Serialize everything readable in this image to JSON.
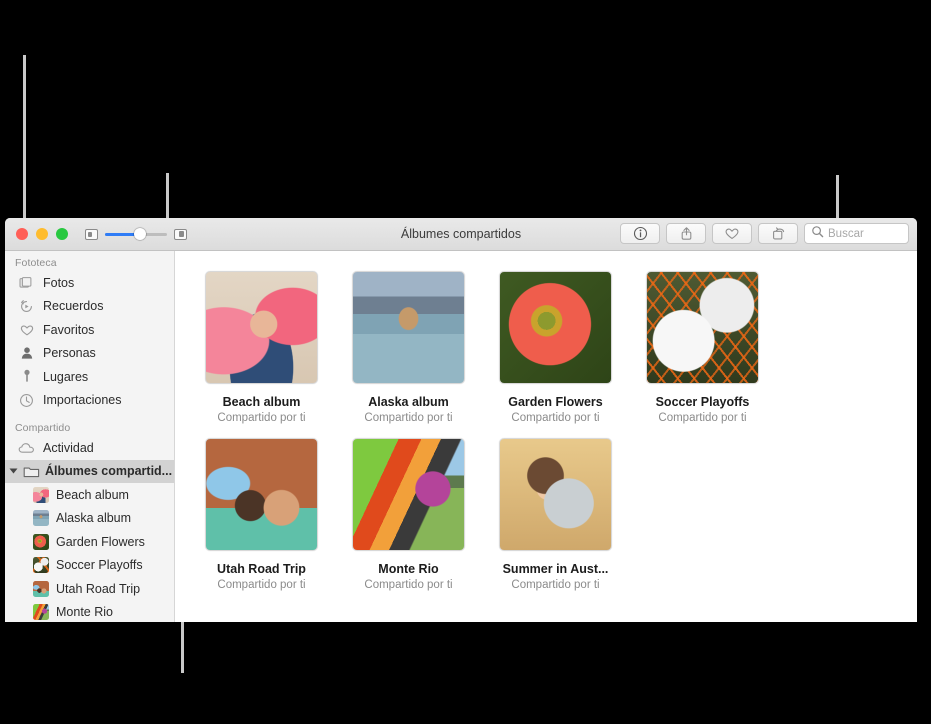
{
  "window": {
    "title": "Álbumes compartidos",
    "traffic_lights": [
      "close",
      "minimize",
      "zoom"
    ],
    "zoom_slider": {
      "value_percent": 50,
      "small_icon": "thumbnail-small-icon",
      "large_icon": "thumbnail-large-icon"
    },
    "toolbar_buttons": [
      {
        "name": "info-button",
        "icon": "info-icon"
      },
      {
        "name": "share-button",
        "icon": "share-icon"
      },
      {
        "name": "favorite-button",
        "icon": "heart-icon"
      },
      {
        "name": "rotate-button",
        "icon": "rotate-icon"
      }
    ],
    "search": {
      "placeholder": "Buscar",
      "icon": "search-icon"
    }
  },
  "sidebar": {
    "sections": [
      {
        "header": "Fototeca",
        "items": [
          {
            "label": "Fotos",
            "icon": "photos-stack-icon"
          },
          {
            "label": "Recuerdos",
            "icon": "memories-rewind-icon"
          },
          {
            "label": "Favoritos",
            "icon": "heart-icon"
          },
          {
            "label": "Personas",
            "icon": "person-icon"
          },
          {
            "label": "Lugares",
            "icon": "map-pin-icon"
          },
          {
            "label": "Importaciones",
            "icon": "clock-icon"
          }
        ]
      },
      {
        "header": "Compartido",
        "items": [
          {
            "label": "Actividad",
            "icon": "cloud-icon"
          },
          {
            "label": "Álbumes compartid...",
            "icon": "folder-icon",
            "selected": true,
            "expanded": true
          }
        ],
        "children": [
          {
            "label": "Beach album",
            "thumb": "p-beach"
          },
          {
            "label": "Alaska album",
            "thumb": "p-alaska"
          },
          {
            "label": "Garden Flowers",
            "thumb": "p-garden"
          },
          {
            "label": "Soccer Playoffs",
            "thumb": "p-soccer"
          },
          {
            "label": "Utah Road Trip",
            "thumb": "p-utah"
          },
          {
            "label": "Monte Rio",
            "thumb": "p-monte"
          }
        ]
      }
    ]
  },
  "main": {
    "albums": [
      {
        "name": "Beach album",
        "subtitle": "Compartido por ti",
        "thumb": "p-beach"
      },
      {
        "name": "Alaska album",
        "subtitle": "Compartido por ti",
        "thumb": "p-alaska"
      },
      {
        "name": "Garden Flowers",
        "subtitle": "Compartido por ti",
        "thumb": "p-garden"
      },
      {
        "name": "Soccer Playoffs",
        "subtitle": "Compartido por ti",
        "thumb": "p-soccer"
      },
      {
        "name": "Utah Road Trip",
        "subtitle": "Compartido por ti",
        "thumb": "p-utah"
      },
      {
        "name": "Monte Rio",
        "subtitle": "Compartido por ti",
        "thumb": "p-monte"
      },
      {
        "name": "Summer in Aust...",
        "subtitle": "Compartido por ti",
        "thumb": "p-summer"
      }
    ]
  },
  "colors": {
    "accent": "#2f7cf6",
    "selection": "#d2d2d2",
    "sidebar_bg": "#f4f4f4",
    "callout_line": "#c9c9c9",
    "background": "#000000"
  }
}
